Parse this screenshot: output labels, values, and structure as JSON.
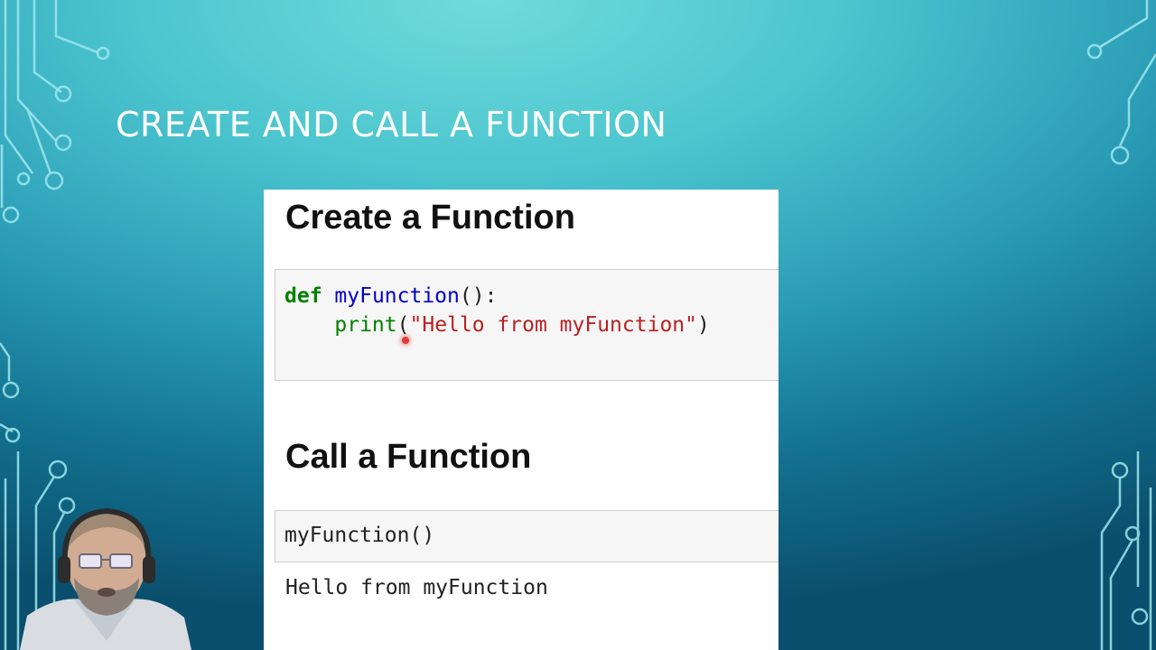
{
  "slide": {
    "title": "CREATE AND CALL A FUNCTION"
  },
  "notebook": {
    "heading_create": "Create a Function",
    "cell1": {
      "line1": {
        "keyword": "def",
        "space": " ",
        "name": "myFunction",
        "rest": "():"
      },
      "line2": {
        "indent": "    ",
        "builtin": "print",
        "open": "(",
        "string": "\"Hello from myFunction\"",
        "close": ")"
      }
    },
    "heading_call": "Call a Function",
    "cell2": {
      "code": "myFunction()"
    },
    "output": "Hello from myFunction"
  },
  "colors": {
    "background_top": "#6fdbdb",
    "background_bottom": "#0b4f6e",
    "keyword": "#008000",
    "function_name": "#0000cc",
    "string": "#ba2121",
    "cursor": "#e23a3a"
  },
  "icons": [
    "circuit-decoration-left",
    "circuit-decoration-right",
    "mouse-cursor-highlight",
    "presenter-webcam"
  ]
}
